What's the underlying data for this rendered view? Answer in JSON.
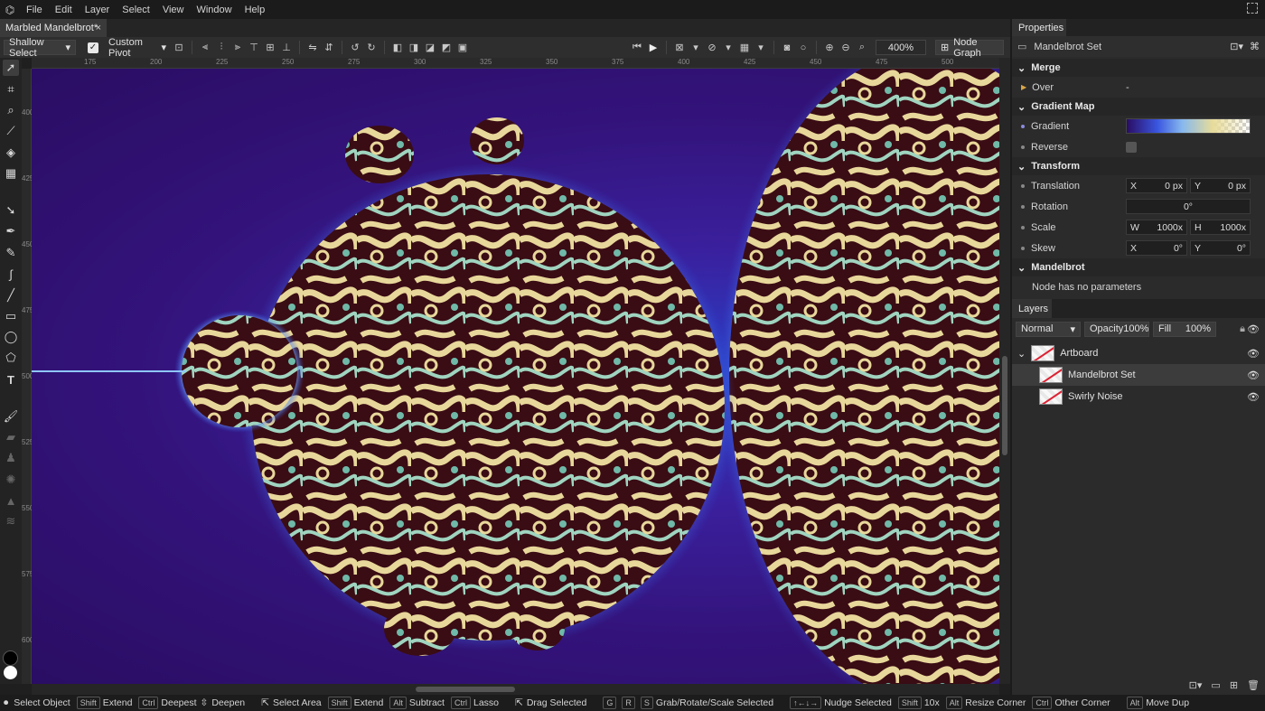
{
  "menubar": {
    "items": [
      "File",
      "Edit",
      "Layer",
      "Select",
      "View",
      "Window",
      "Help"
    ]
  },
  "document": {
    "tab_title": "Marbled Mandelbrot*",
    "close": "×"
  },
  "options": {
    "select_mode": "Shallow Select",
    "pivot_label": "Custom Pivot",
    "zoom": "400%",
    "node_graph": "Node Graph"
  },
  "ruler": {
    "h_ticks": [
      "175",
      "200",
      "225",
      "250",
      "275",
      "300",
      "325",
      "350",
      "375",
      "400",
      "425",
      "450",
      "475",
      "500"
    ],
    "v_ticks": [
      "400",
      "425",
      "450",
      "475",
      "500",
      "525",
      "550",
      "575",
      "600"
    ]
  },
  "properties": {
    "tab": "Properties",
    "node_name": "Mandelbrot Set",
    "merge": {
      "title": "Merge",
      "mode_label": "Over",
      "mode_value": "-"
    },
    "gradient_map": {
      "title": "Gradient Map",
      "gradient_label": "Gradient",
      "reverse_label": "Reverse"
    },
    "transform": {
      "title": "Transform",
      "translation_label": "Translation",
      "tx_axis": "X",
      "tx": "0 px",
      "ty_axis": "Y",
      "ty": "0 px",
      "rotation_label": "Rotation",
      "rotation": "0°",
      "scale_label": "Scale",
      "sw_axis": "W",
      "sw": "1000x",
      "sh_axis": "H",
      "sh": "1000x",
      "skew_label": "Skew",
      "kx_axis": "X",
      "kx": "0°",
      "ky_axis": "Y",
      "ky": "0°"
    },
    "mandelbrot": {
      "title": "Mandelbrot",
      "note": "Node has no parameters"
    }
  },
  "layers": {
    "tab": "Layers",
    "blend_mode": "Normal",
    "opacity_label": "Opacity",
    "opacity": "100%",
    "fill_label": "Fill",
    "fill": "100%",
    "items": [
      {
        "name": "Artboard"
      },
      {
        "name": "Mandelbrot Set"
      },
      {
        "name": "Swirly Noise"
      }
    ]
  },
  "status": {
    "select_object": "Select Object",
    "shift": "Shift",
    "extend": "Extend",
    "ctrl": "Ctrl",
    "deepest": "Deepest",
    "deepen": "Deepen",
    "select_area": "Select Area",
    "extend2": "Extend",
    "alt": "Alt",
    "subtract": "Subtract",
    "lasso": "Lasso",
    "drag_selected": "Drag Selected",
    "g": "G",
    "r": "R",
    "s": "S",
    "grab": "Grab/Rotate/Scale Selected",
    "nudge": "Nudge Selected",
    "tenx": "10x",
    "resize_corner": "Resize Corner",
    "other_corner": "Other Corner",
    "move_dup": "Move Dup"
  },
  "colors": {
    "accent": "#4a7bd6",
    "canvas_bg": "#33137a",
    "panel": "#2b2b2b"
  }
}
